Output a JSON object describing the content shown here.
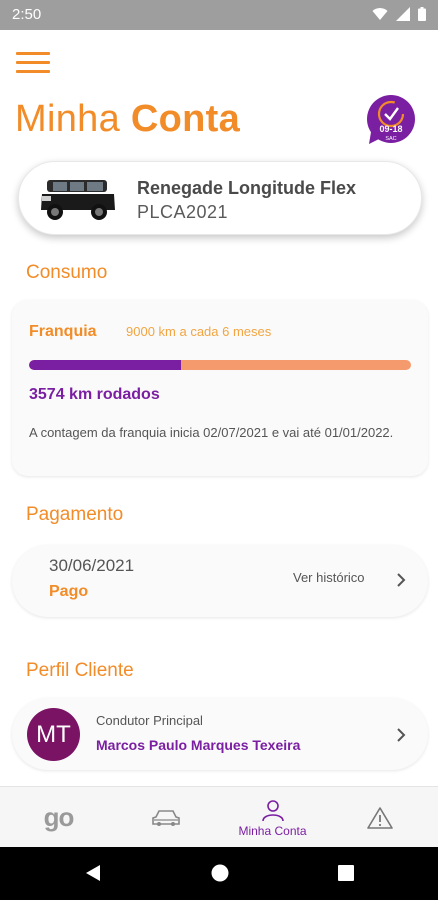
{
  "status_bar": {
    "time": "2:50"
  },
  "header": {
    "title_regular": "Minha ",
    "title_bold": "Conta",
    "sac_hours": "09-18",
    "sac_label": "SAC"
  },
  "car": {
    "name": "Renegade Longitude Flex",
    "plate": "PLCA2021"
  },
  "consumo": {
    "section_title": "Consumo",
    "franquia_label": "Franquia",
    "franquia_value": "9000 km a cada 6 meses",
    "progress_fraction": 0.397,
    "km_rodados": "3574 km rodados",
    "note": "A contagem da franquia inicia 02/07/2021 e vai até 01/01/2022."
  },
  "pagamento": {
    "section_title": "Pagamento",
    "date": "30/06/2021",
    "status": "Pago",
    "link": "Ver histórico"
  },
  "perfil": {
    "section_title": "Perfil Cliente",
    "initials": "MT",
    "role": "Condutor Principal",
    "name": "Marcos Paulo Marques Texeira"
  },
  "bottom_nav": {
    "items": [
      {
        "label": "go",
        "icon": "go-logo"
      },
      {
        "label": "",
        "icon": "car-icon"
      },
      {
        "label": "Minha Conta",
        "icon": "person-icon",
        "active": true
      },
      {
        "label": "",
        "icon": "warning-icon"
      }
    ]
  },
  "colors": {
    "orange": "#f28c28",
    "purple": "#7b1fa2",
    "progress_track": "#f59a6c",
    "avatar": "#7b1364"
  }
}
